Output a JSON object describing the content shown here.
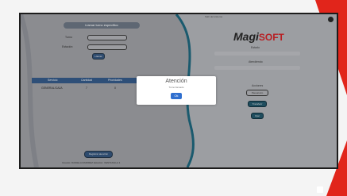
{
  "screen": {
    "top_caption": "Salir del sistema",
    "left_panel": {
      "title": "Llamar turno específico",
      "turno_label": "Turno",
      "estacion_label": "Estación",
      "llamar_button": "Llamar"
    },
    "table": {
      "headers": [
        "Servicio",
        "Cantidad",
        "Prioridades"
      ],
      "rows": [
        [
          "GENERAL/CAJA",
          "7",
          "0"
        ]
      ]
    },
    "bottom": {
      "button": "Registrar atención",
      "caption": "Usuario: DANIELA RAMIREZ Estación: VENTANILLA 1"
    },
    "right_panel": {
      "logo_main": "Magi",
      "logo_accent": "SOFT",
      "label_1": "Estado",
      "label_2": "Atendiendo",
      "section_label": "Acciones",
      "input_placeholder": "Pausa/otro",
      "btn_1": "Transferir",
      "btn_2": "Fijar"
    }
  },
  "modal": {
    "title": "Atención",
    "message": "Turno llamado",
    "ok_label": "Ok"
  },
  "colors": {
    "accent_red": "#e1251b",
    "modal_button": "#2f6fcf",
    "table_header": "#2e4f78"
  }
}
